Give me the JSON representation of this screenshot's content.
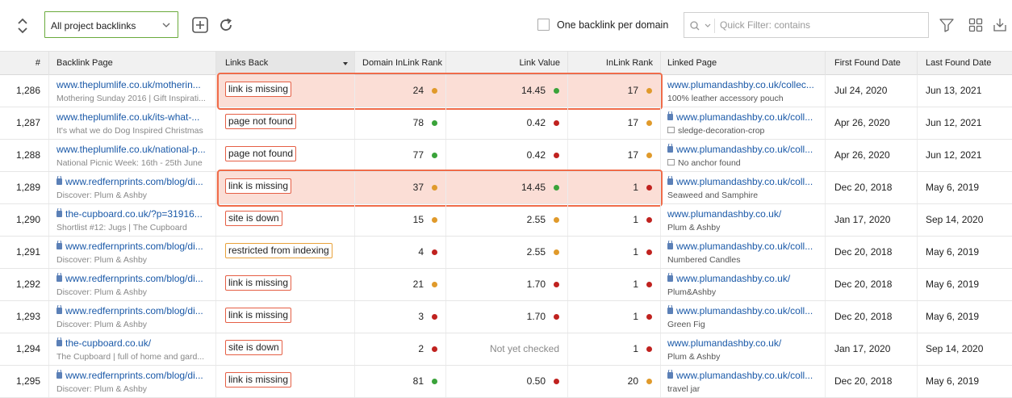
{
  "toolbar": {
    "dropdown_value": "All project backlinks",
    "checkbox_label": "One backlink per domain",
    "filter_placeholder": "Quick Filter: contains"
  },
  "columns": {
    "num": "#",
    "backlink_page": "Backlink Page",
    "links_back": "Links Back",
    "domain_inlink_rank": "Domain InLink Rank",
    "link_value": "Link Value",
    "inlink_rank": "InLink Rank",
    "linked_page": "Linked Page",
    "first_found": "First Found Date",
    "last_found": "Last Found Date"
  },
  "colors": {
    "green": "#3aa33a",
    "red": "#c0221f",
    "orange": "#e09a2b",
    "highlight": "#fbded6",
    "accent": "#f06c4a"
  },
  "rows": [
    {
      "num": "1,286",
      "bp_url": "www.theplumlife.co.uk/motherin...",
      "bp_secure": false,
      "bp_sub": "Mothering Sunday 2016 | Gift Inspirati...",
      "status": "link is missing",
      "status_color": "red",
      "dr": "24",
      "dr_dot": "orange",
      "lv": "14.45",
      "lv_dot": "green",
      "ir": "17",
      "ir_dot": "orange",
      "lp_url": "www.plumandashby.co.uk/collec...",
      "lp_secure": false,
      "lp_sub": "100% leather accessory pouch",
      "lp_sub_icon": "none",
      "first": "Jul 24, 2020",
      "last": "Jun 13, 2021",
      "highlight": true
    },
    {
      "num": "1,287",
      "bp_url": "www.theplumlife.co.uk/its-what-...",
      "bp_secure": false,
      "bp_sub": "It's what we do Dog Inspired Christmas",
      "status": "page not found",
      "status_color": "red",
      "dr": "78",
      "dr_dot": "green",
      "lv": "0.42",
      "lv_dot": "red",
      "ir": "17",
      "ir_dot": "orange",
      "lp_url": "www.plumandashby.co.uk/coll...",
      "lp_secure": true,
      "lp_sub": "sledge-decoration-crop",
      "lp_sub_icon": "image",
      "first": "Apr 26, 2020",
      "last": "Jun 12, 2021",
      "highlight": false
    },
    {
      "num": "1,288",
      "bp_url": "www.theplumlife.co.uk/national-p...",
      "bp_secure": false,
      "bp_sub": "National Picnic Week: 16th - 25th June",
      "status": "page not found",
      "status_color": "red",
      "dr": "77",
      "dr_dot": "green",
      "lv": "0.42",
      "lv_dot": "red",
      "ir": "17",
      "ir_dot": "orange",
      "lp_url": "www.plumandashby.co.uk/coll...",
      "lp_secure": true,
      "lp_sub": "No anchor found",
      "lp_sub_icon": "image",
      "first": "Apr 26, 2020",
      "last": "Jun 12, 2021",
      "highlight": false
    },
    {
      "num": "1,289",
      "bp_url": "www.redfernprints.com/blog/di...",
      "bp_secure": true,
      "bp_sub": "Discover: Plum & Ashby",
      "status": "link is missing",
      "status_color": "red",
      "dr": "37",
      "dr_dot": "orange",
      "lv": "14.45",
      "lv_dot": "green",
      "ir": "1",
      "ir_dot": "red",
      "lp_url": "www.plumandashby.co.uk/coll...",
      "lp_secure": true,
      "lp_sub": "Seaweed and Samphire",
      "lp_sub_icon": "none",
      "first": "Dec 20, 2018",
      "last": "May 6, 2019",
      "highlight": true
    },
    {
      "num": "1,290",
      "bp_url": "the-cupboard.co.uk/?p=31916...",
      "bp_secure": true,
      "bp_sub": "Shortlist #12: Jugs | The Cupboard",
      "status": "site is down",
      "status_color": "red",
      "dr": "15",
      "dr_dot": "orange",
      "lv": "2.55",
      "lv_dot": "orange",
      "ir": "1",
      "ir_dot": "red",
      "lp_url": "www.plumandashby.co.uk/",
      "lp_secure": false,
      "lp_sub": "Plum & Ashby",
      "lp_sub_icon": "none",
      "first": "Jan 17, 2020",
      "last": "Sep 14, 2020",
      "highlight": false
    },
    {
      "num": "1,291",
      "bp_url": "www.redfernprints.com/blog/di...",
      "bp_secure": true,
      "bp_sub": "Discover: Plum & Ashby",
      "status": "restricted from indexing",
      "status_color": "orange",
      "dr": "4",
      "dr_dot": "red",
      "lv": "2.55",
      "lv_dot": "orange",
      "ir": "1",
      "ir_dot": "red",
      "lp_url": "www.plumandashby.co.uk/coll...",
      "lp_secure": true,
      "lp_sub": "Numbered Candles",
      "lp_sub_icon": "none",
      "first": "Dec 20, 2018",
      "last": "May 6, 2019",
      "highlight": false
    },
    {
      "num": "1,292",
      "bp_url": "www.redfernprints.com/blog/di...",
      "bp_secure": true,
      "bp_sub": "Discover: Plum & Ashby",
      "status": "link is missing",
      "status_color": "red",
      "dr": "21",
      "dr_dot": "orange",
      "lv": "1.70",
      "lv_dot": "red",
      "ir": "1",
      "ir_dot": "red",
      "lp_url": "www.plumandashby.co.uk/",
      "lp_secure": true,
      "lp_sub": "Plum&Ashby",
      "lp_sub_icon": "none",
      "first": "Dec 20, 2018",
      "last": "May 6, 2019",
      "highlight": false
    },
    {
      "num": "1,293",
      "bp_url": "www.redfernprints.com/blog/di...",
      "bp_secure": true,
      "bp_sub": "Discover: Plum & Ashby",
      "status": "link is missing",
      "status_color": "red",
      "dr": "3",
      "dr_dot": "red",
      "lv": "1.70",
      "lv_dot": "red",
      "ir": "1",
      "ir_dot": "red",
      "lp_url": "www.plumandashby.co.uk/coll...",
      "lp_secure": true,
      "lp_sub": "Green Fig",
      "lp_sub_icon": "none",
      "first": "Dec 20, 2018",
      "last": "May 6, 2019",
      "highlight": false
    },
    {
      "num": "1,294",
      "bp_url": "the-cupboard.co.uk/",
      "bp_secure": true,
      "bp_sub": "The Cupboard | full of home and gard...",
      "status": "site is down",
      "status_color": "red",
      "dr": "2",
      "dr_dot": "red",
      "lv": "Not yet checked",
      "lv_dot": "none",
      "ir": "1",
      "ir_dot": "red",
      "lp_url": "www.plumandashby.co.uk/",
      "lp_secure": false,
      "lp_sub": "Plum & Ashby",
      "lp_sub_icon": "none",
      "first": "Jan 17, 2020",
      "last": "Sep 14, 2020",
      "highlight": false
    },
    {
      "num": "1,295",
      "bp_url": "www.redfernprints.com/blog/di...",
      "bp_secure": true,
      "bp_sub": "Discover: Plum & Ashby",
      "status": "link is missing",
      "status_color": "red",
      "dr": "81",
      "dr_dot": "green",
      "lv": "0.50",
      "lv_dot": "red",
      "ir": "20",
      "ir_dot": "orange",
      "lp_url": "www.plumandashby.co.uk/coll...",
      "lp_secure": true,
      "lp_sub": "travel jar",
      "lp_sub_icon": "none",
      "first": "Dec 20, 2018",
      "last": "May 6, 2019",
      "highlight": false
    }
  ]
}
